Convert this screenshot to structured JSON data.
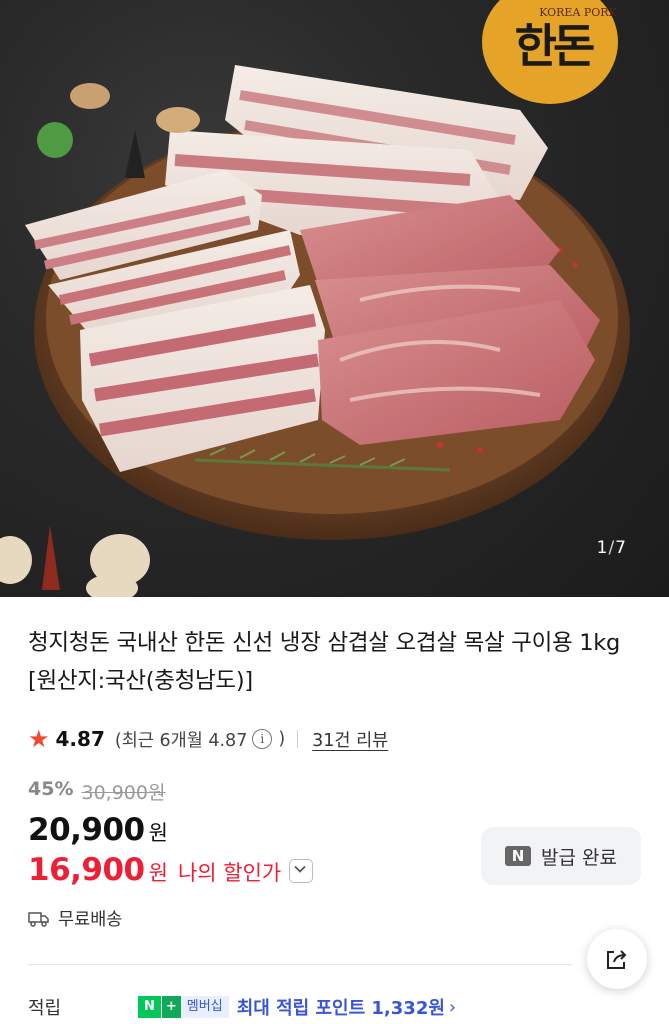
{
  "gallery": {
    "current": "1",
    "separator": "/",
    "total": "7",
    "logo_text": "KOREA PORK",
    "logo_hangul": "한돈"
  },
  "product": {
    "title": "청지청돈 국내산 한돈 신선 냉장 삼겹살 오겹살 목살 구이용 1kg [원산지:국산(충청남도)]",
    "rating": "4.87",
    "recent_prefix": "(최근 6개월 4.87",
    "recent_suffix": ")",
    "review_link": "31건 리뷰"
  },
  "pricing": {
    "discount_rate": "45%",
    "original_price": "30,900원",
    "price": "20,900",
    "price_unit": "원",
    "my_price": "16,900",
    "my_price_unit": "원",
    "my_price_label": "나의 할인가",
    "coupon_badge": "N",
    "coupon_label": "발급 완료"
  },
  "shipping": {
    "label": "무료배송"
  },
  "points": {
    "label": "적립",
    "badge_n": "N",
    "badge_plus": "+",
    "badge_membership": "멤버십",
    "text": "최대 적립 포인트 1,332원",
    "chevron": "›"
  },
  "colors": {
    "sale_red": "#ec1f35",
    "star_orange": "#f04a2f",
    "naver_green": "#03c75a",
    "points_blue": "#3a55d8"
  }
}
